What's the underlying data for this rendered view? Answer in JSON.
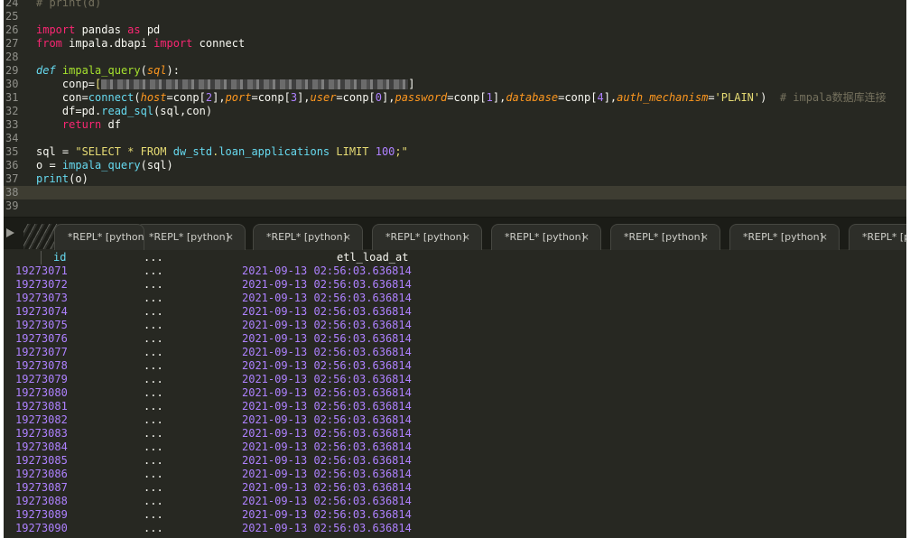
{
  "editor": {
    "lines": [
      {
        "n": "24",
        "tokens": [
          {
            "t": "# print(d)",
            "c": "cmt"
          }
        ]
      },
      {
        "n": "25",
        "tokens": []
      },
      {
        "n": "26",
        "tokens": [
          {
            "t": "import",
            "c": "kw"
          },
          {
            "t": " pandas "
          },
          {
            "t": "as",
            "c": "kw"
          },
          {
            "t": " pd"
          }
        ]
      },
      {
        "n": "27",
        "tokens": [
          {
            "t": "from",
            "c": "kw"
          },
          {
            "t": " impala.dbapi "
          },
          {
            "t": "import",
            "c": "kw"
          },
          {
            "t": " connect"
          }
        ]
      },
      {
        "n": "28",
        "tokens": []
      },
      {
        "n": "29",
        "tokens": [
          {
            "t": "def",
            "c": "def"
          },
          {
            "t": " "
          },
          {
            "t": "impala_query",
            "c": "fn"
          },
          {
            "t": "("
          },
          {
            "t": "sql",
            "c": "param"
          },
          {
            "t": "):"
          }
        ]
      },
      {
        "n": "30",
        "tokens": [
          {
            "t": "    conp="
          },
          {
            "t": "[",
            "c": "str"
          },
          {
            "blur": 340
          },
          {
            "t": "]"
          }
        ]
      },
      {
        "n": "31",
        "tokens": [
          {
            "t": "    con="
          },
          {
            "t": "connect",
            "c": "bi"
          },
          {
            "t": "("
          },
          {
            "t": "host",
            "c": "param"
          },
          {
            "t": "="
          },
          {
            "t": "conp["
          },
          {
            "t": "2",
            "c": "num"
          },
          {
            "t": "],"
          },
          {
            "t": "port",
            "c": "param"
          },
          {
            "t": "=conp["
          },
          {
            "t": "3",
            "c": "num"
          },
          {
            "t": "],"
          },
          {
            "t": "user",
            "c": "param"
          },
          {
            "t": "=conp["
          },
          {
            "t": "0",
            "c": "num"
          },
          {
            "t": "],"
          },
          {
            "t": "password",
            "c": "param"
          },
          {
            "t": "=conp["
          },
          {
            "t": "1",
            "c": "num"
          },
          {
            "t": "],"
          },
          {
            "t": "database",
            "c": "param"
          },
          {
            "t": "=conp["
          },
          {
            "t": "4",
            "c": "num"
          },
          {
            "t": "],"
          },
          {
            "t": "auth_mechanism",
            "c": "param"
          },
          {
            "t": "="
          },
          {
            "t": "'PLAIN'",
            "c": "str"
          },
          {
            "t": ")  "
          },
          {
            "t": "# impala数据库连接",
            "c": "cmt"
          }
        ]
      },
      {
        "n": "32",
        "tokens": [
          {
            "t": "    df=pd."
          },
          {
            "t": "read_sql",
            "c": "bi"
          },
          {
            "t": "(sql,con)"
          }
        ]
      },
      {
        "n": "33",
        "tokens": [
          {
            "t": "    "
          },
          {
            "t": "return",
            "c": "kw"
          },
          {
            "t": " df"
          }
        ]
      },
      {
        "n": "34",
        "tokens": []
      },
      {
        "n": "35",
        "tokens": [
          {
            "t": "sql = "
          },
          {
            "t": "\"SELECT * FROM ",
            "c": "str"
          },
          {
            "t": "dw_std",
            "c": "bi"
          },
          {
            "t": ".",
            "c": "str"
          },
          {
            "t": "loan_applications",
            "c": "bi"
          },
          {
            "t": " LIMIT ",
            "c": "str"
          },
          {
            "t": "100",
            "c": "num"
          },
          {
            "t": ";\"",
            "c": "str"
          }
        ]
      },
      {
        "n": "36",
        "tokens": [
          {
            "t": "o = "
          },
          {
            "t": "impala_query",
            "c": "bi"
          },
          {
            "t": "(sql)"
          }
        ]
      },
      {
        "n": "37",
        "tokens": [
          {
            "t": "print",
            "c": "bi"
          },
          {
            "t": "(o)"
          }
        ]
      },
      {
        "n": "38",
        "tokens": [],
        "current": true
      },
      {
        "n": "39",
        "tokens": []
      }
    ]
  },
  "tabs": [
    {
      "label": "*REPL* [python]",
      "close": "×"
    },
    {
      "label": "*REPL* [python]",
      "close": "×"
    },
    {
      "label": "*REPL* [python]",
      "close": "×"
    },
    {
      "label": "*REPL* [python]",
      "close": "×"
    },
    {
      "label": "*REPL* [python]",
      "close": "×"
    },
    {
      "label": "*REPL* [python]",
      "close": "×"
    },
    {
      "label": "*REPL* [python]",
      "close": "×"
    },
    {
      "label": "*REPL* [python]",
      "close": "×"
    }
  ],
  "repl": {
    "header": {
      "col1": "id",
      "col2": "...",
      "col3": "etl_load_at"
    },
    "rows": [
      {
        "id": "19273071",
        "mid": "...",
        "ts": "2021-09-13 02:56:03.636814"
      },
      {
        "id": "19273072",
        "mid": "...",
        "ts": "2021-09-13 02:56:03.636814"
      },
      {
        "id": "19273073",
        "mid": "...",
        "ts": "2021-09-13 02:56:03.636814"
      },
      {
        "id": "19273074",
        "mid": "...",
        "ts": "2021-09-13 02:56:03.636814"
      },
      {
        "id": "19273075",
        "mid": "...",
        "ts": "2021-09-13 02:56:03.636814"
      },
      {
        "id": "19273076",
        "mid": "...",
        "ts": "2021-09-13 02:56:03.636814"
      },
      {
        "id": "19273077",
        "mid": "...",
        "ts": "2021-09-13 02:56:03.636814"
      },
      {
        "id": "19273078",
        "mid": "...",
        "ts": "2021-09-13 02:56:03.636814"
      },
      {
        "id": "19273079",
        "mid": "...",
        "ts": "2021-09-13 02:56:03.636814"
      },
      {
        "id": "19273080",
        "mid": "...",
        "ts": "2021-09-13 02:56:03.636814"
      },
      {
        "id": "19273081",
        "mid": "...",
        "ts": "2021-09-13 02:56:03.636814"
      },
      {
        "id": "19273082",
        "mid": "...",
        "ts": "2021-09-13 02:56:03.636814"
      },
      {
        "id": "19273083",
        "mid": "...",
        "ts": "2021-09-13 02:56:03.636814"
      },
      {
        "id": "19273084",
        "mid": "...",
        "ts": "2021-09-13 02:56:03.636814"
      },
      {
        "id": "19273085",
        "mid": "...",
        "ts": "2021-09-13 02:56:03.636814"
      },
      {
        "id": "19273086",
        "mid": "...",
        "ts": "2021-09-13 02:56:03.636814"
      },
      {
        "id": "19273087",
        "mid": "...",
        "ts": "2021-09-13 02:56:03.636814"
      },
      {
        "id": "19273088",
        "mid": "...",
        "ts": "2021-09-13 02:56:03.636814"
      },
      {
        "id": "19273089",
        "mid": "...",
        "ts": "2021-09-13 02:56:03.636814"
      },
      {
        "id": "19273090",
        "mid": "...",
        "ts": "2021-09-13 02:56:03.636814"
      }
    ]
  }
}
